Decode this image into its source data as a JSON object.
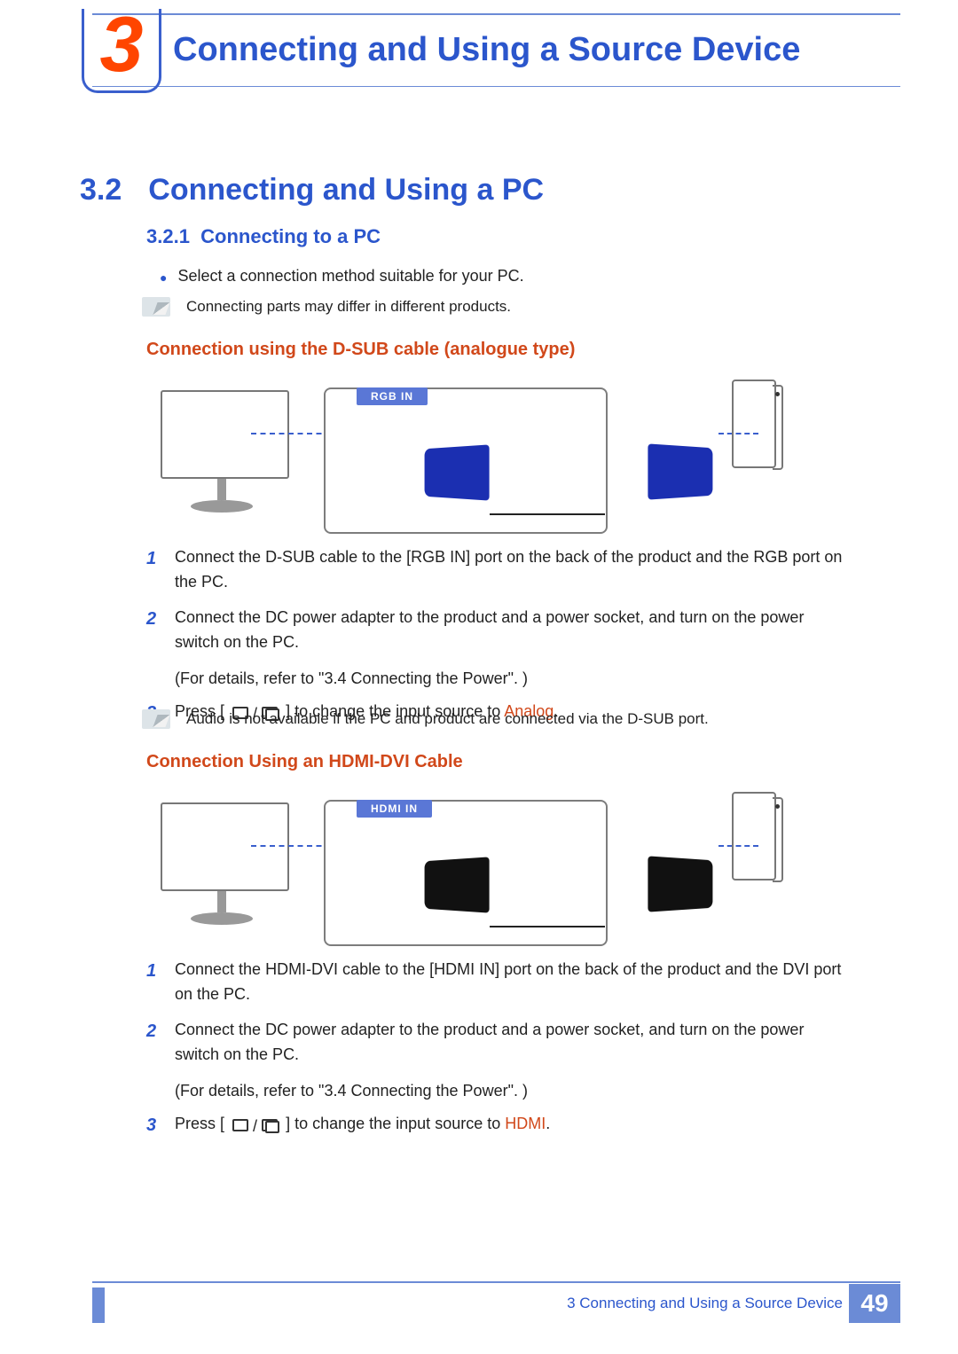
{
  "chapter": {
    "number": "3",
    "title": "Connecting and Using a Source Device"
  },
  "section": {
    "number": "3.2",
    "title": "Connecting and Using a PC"
  },
  "subsection": {
    "number": "3.2.1",
    "title": "Connecting to a PC"
  },
  "bullet1": "Select a connection method suitable for your PC.",
  "note_diff": "Connecting parts may differ in different products.",
  "dsub": {
    "heading": "Connection using the D-SUB cable (analogue type)",
    "tag": "RGB IN",
    "steps": {
      "s1": "Connect the D-SUB cable to the [RGB IN] port on the back of the product and the RGB port on the PC.",
      "s2a": "Connect the DC power adapter to the product and a power socket, and turn on the power switch on the PC.",
      "s2b": "(For details, refer to \"3.4 Connecting the Power\". )",
      "s3a": "Press [",
      "s3b": "] to change the input source to ",
      "s3kw": "Analog",
      "s3c": "."
    },
    "note": "Audio is not available if the PC and product are connected via the D-SUB port."
  },
  "hdmi": {
    "heading": "Connection Using an HDMI-DVI Cable",
    "tag": "HDMI IN",
    "steps": {
      "s1": "Connect the HDMI-DVI cable to the [HDMI IN] port on the back of the product and the DVI port on the PC.",
      "s2a": "Connect the DC power adapter to the product and a power socket, and turn on the power switch on the PC.",
      "s2b": "(For details, refer to \"3.4 Connecting the Power\". )",
      "s3a": "Press [",
      "s3b": "] to change the input source to ",
      "s3kw": "HDMI",
      "s3c": "."
    }
  },
  "footer": {
    "chapter_ref": "3 Connecting and Using a Source Device",
    "page": "49"
  }
}
